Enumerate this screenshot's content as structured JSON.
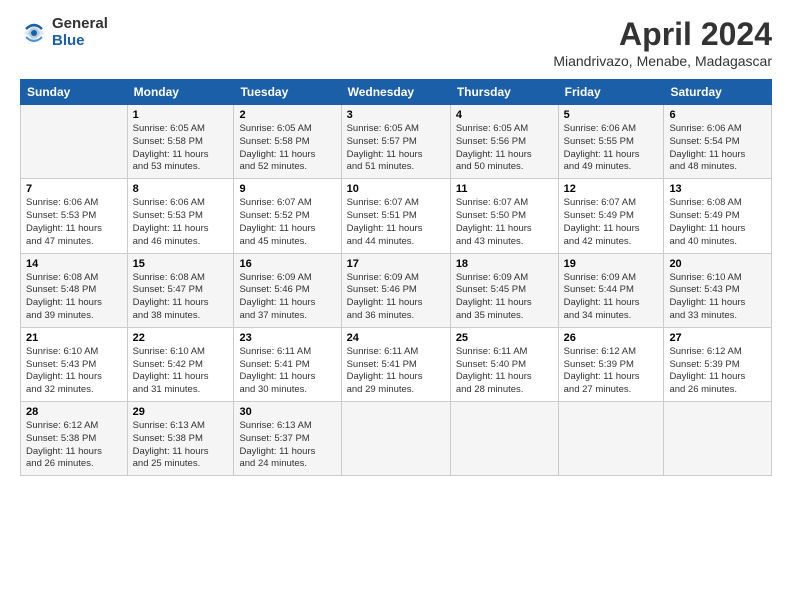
{
  "header": {
    "logo_general": "General",
    "logo_blue": "Blue",
    "main_title": "April 2024",
    "subtitle": "Miandrivazo, Menabe, Madagascar"
  },
  "calendar": {
    "days_of_week": [
      "Sunday",
      "Monday",
      "Tuesday",
      "Wednesday",
      "Thursday",
      "Friday",
      "Saturday"
    ],
    "weeks": [
      [
        {
          "day": "",
          "info": ""
        },
        {
          "day": "1",
          "info": "Sunrise: 6:05 AM\nSunset: 5:58 PM\nDaylight: 11 hours\nand 53 minutes."
        },
        {
          "day": "2",
          "info": "Sunrise: 6:05 AM\nSunset: 5:58 PM\nDaylight: 11 hours\nand 52 minutes."
        },
        {
          "day": "3",
          "info": "Sunrise: 6:05 AM\nSunset: 5:57 PM\nDaylight: 11 hours\nand 51 minutes."
        },
        {
          "day": "4",
          "info": "Sunrise: 6:05 AM\nSunset: 5:56 PM\nDaylight: 11 hours\nand 50 minutes."
        },
        {
          "day": "5",
          "info": "Sunrise: 6:06 AM\nSunset: 5:55 PM\nDaylight: 11 hours\nand 49 minutes."
        },
        {
          "day": "6",
          "info": "Sunrise: 6:06 AM\nSunset: 5:54 PM\nDaylight: 11 hours\nand 48 minutes."
        }
      ],
      [
        {
          "day": "7",
          "info": "Sunrise: 6:06 AM\nSunset: 5:53 PM\nDaylight: 11 hours\nand 47 minutes."
        },
        {
          "day": "8",
          "info": "Sunrise: 6:06 AM\nSunset: 5:53 PM\nDaylight: 11 hours\nand 46 minutes."
        },
        {
          "day": "9",
          "info": "Sunrise: 6:07 AM\nSunset: 5:52 PM\nDaylight: 11 hours\nand 45 minutes."
        },
        {
          "day": "10",
          "info": "Sunrise: 6:07 AM\nSunset: 5:51 PM\nDaylight: 11 hours\nand 44 minutes."
        },
        {
          "day": "11",
          "info": "Sunrise: 6:07 AM\nSunset: 5:50 PM\nDaylight: 11 hours\nand 43 minutes."
        },
        {
          "day": "12",
          "info": "Sunrise: 6:07 AM\nSunset: 5:49 PM\nDaylight: 11 hours\nand 42 minutes."
        },
        {
          "day": "13",
          "info": "Sunrise: 6:08 AM\nSunset: 5:49 PM\nDaylight: 11 hours\nand 40 minutes."
        }
      ],
      [
        {
          "day": "14",
          "info": "Sunrise: 6:08 AM\nSunset: 5:48 PM\nDaylight: 11 hours\nand 39 minutes."
        },
        {
          "day": "15",
          "info": "Sunrise: 6:08 AM\nSunset: 5:47 PM\nDaylight: 11 hours\nand 38 minutes."
        },
        {
          "day": "16",
          "info": "Sunrise: 6:09 AM\nSunset: 5:46 PM\nDaylight: 11 hours\nand 37 minutes."
        },
        {
          "day": "17",
          "info": "Sunrise: 6:09 AM\nSunset: 5:46 PM\nDaylight: 11 hours\nand 36 minutes."
        },
        {
          "day": "18",
          "info": "Sunrise: 6:09 AM\nSunset: 5:45 PM\nDaylight: 11 hours\nand 35 minutes."
        },
        {
          "day": "19",
          "info": "Sunrise: 6:09 AM\nSunset: 5:44 PM\nDaylight: 11 hours\nand 34 minutes."
        },
        {
          "day": "20",
          "info": "Sunrise: 6:10 AM\nSunset: 5:43 PM\nDaylight: 11 hours\nand 33 minutes."
        }
      ],
      [
        {
          "day": "21",
          "info": "Sunrise: 6:10 AM\nSunset: 5:43 PM\nDaylight: 11 hours\nand 32 minutes."
        },
        {
          "day": "22",
          "info": "Sunrise: 6:10 AM\nSunset: 5:42 PM\nDaylight: 11 hours\nand 31 minutes."
        },
        {
          "day": "23",
          "info": "Sunrise: 6:11 AM\nSunset: 5:41 PM\nDaylight: 11 hours\nand 30 minutes."
        },
        {
          "day": "24",
          "info": "Sunrise: 6:11 AM\nSunset: 5:41 PM\nDaylight: 11 hours\nand 29 minutes."
        },
        {
          "day": "25",
          "info": "Sunrise: 6:11 AM\nSunset: 5:40 PM\nDaylight: 11 hours\nand 28 minutes."
        },
        {
          "day": "26",
          "info": "Sunrise: 6:12 AM\nSunset: 5:39 PM\nDaylight: 11 hours\nand 27 minutes."
        },
        {
          "day": "27",
          "info": "Sunrise: 6:12 AM\nSunset: 5:39 PM\nDaylight: 11 hours\nand 26 minutes."
        }
      ],
      [
        {
          "day": "28",
          "info": "Sunrise: 6:12 AM\nSunset: 5:38 PM\nDaylight: 11 hours\nand 26 minutes."
        },
        {
          "day": "29",
          "info": "Sunrise: 6:13 AM\nSunset: 5:38 PM\nDaylight: 11 hours\nand 25 minutes."
        },
        {
          "day": "30",
          "info": "Sunrise: 6:13 AM\nSunset: 5:37 PM\nDaylight: 11 hours\nand 24 minutes."
        },
        {
          "day": "",
          "info": ""
        },
        {
          "day": "",
          "info": ""
        },
        {
          "day": "",
          "info": ""
        },
        {
          "day": "",
          "info": ""
        }
      ]
    ]
  }
}
